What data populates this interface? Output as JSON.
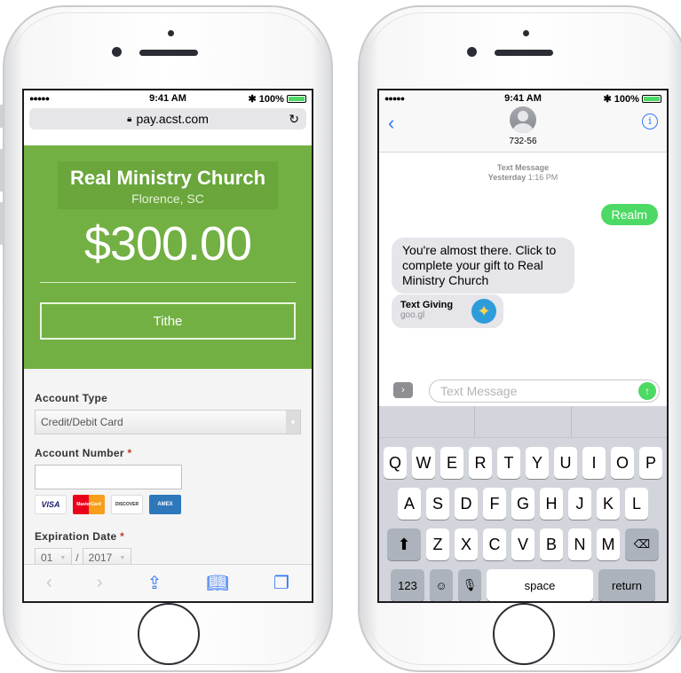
{
  "status": {
    "time": "9:41 AM",
    "battery": "100%",
    "signal": "●●●●●"
  },
  "safari": {
    "url": "pay.acst.com",
    "church_name": "Real Ministry Church",
    "church_city": "Florence, SC",
    "amount": "$300.00",
    "fund": "Tithe",
    "account_type_label": "Account Type",
    "account_type_value": "Credit/Debit Card",
    "account_number_label": "Account Number",
    "required_mark": "*",
    "expiration_label": "Expiration Date",
    "exp_month": "01",
    "exp_year": "2017",
    "exp_separator": "/",
    "cards": [
      "VISA",
      "MasterCard",
      "DISCOVER",
      "AMEX"
    ],
    "colors": {
      "hero": "#73b043",
      "link": "#3478f6"
    }
  },
  "messages": {
    "contact": "732-56",
    "meta_type": "Text Message",
    "meta_day": "Yesterday",
    "meta_time": "1:16 PM",
    "outgoing": "Realm",
    "incoming": "You're almost there. Click to complete your gift to Real Ministry Church",
    "link_title": "Text Giving",
    "link_url": "goo.gl",
    "placeholder": "Text Message",
    "colors": {
      "sent": "#4cd964",
      "received": "#e5e5ea"
    }
  },
  "keyboard": {
    "row1": [
      "Q",
      "W",
      "E",
      "R",
      "T",
      "Y",
      "U",
      "I",
      "O",
      "P"
    ],
    "row2": [
      "A",
      "S",
      "D",
      "F",
      "G",
      "H",
      "J",
      "K",
      "L"
    ],
    "row3": [
      "Z",
      "X",
      "C",
      "V",
      "B",
      "N",
      "M"
    ],
    "numbers": "123",
    "space": "space",
    "return": "return"
  }
}
